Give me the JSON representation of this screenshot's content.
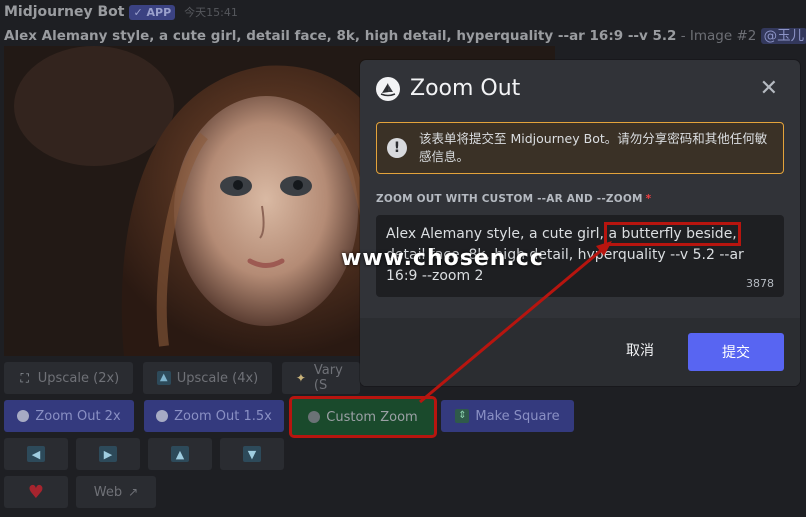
{
  "message": {
    "author": "Midjourney Bot",
    "app_badge": "✓ APP",
    "timestamp": "今天15:41",
    "prompt_bold": "Alex Alemany style, a cute girl, detail face, 8k, high detail, hyperquality --ar 16:9 --v 5.2",
    "prompt_suffix": " - Image #2 ",
    "mention": "@玉儿"
  },
  "buttons": {
    "upscale_2x": "Upscale (2x)",
    "upscale_4x": "Upscale (4x)",
    "vary": "Vary (S",
    "zoom_out_2x": "Zoom Out 2x",
    "zoom_out_15x": "Zoom Out 1.5x",
    "custom_zoom": "Custom Zoom",
    "make_square": "Make Square",
    "web": "Web"
  },
  "modal": {
    "title": "Zoom Out",
    "warning": "该表单将提交至 Midjourney Bot。请勿分享密码和其他任何敏感信息。",
    "field_label": "ZOOM OUT WITH CUSTOM --AR AND --ZOOM",
    "field_required": "*",
    "text_before": "Alex Alemany style, a cute girl,",
    "text_highlight": "a butterfly beside,",
    "text_after": " detail face, 8k, high detail, hyperquality --v 5.2 --ar 16:9 --zoom 2",
    "char_count": "3878",
    "cancel": "取消",
    "submit": "提交"
  },
  "watermark": "www.chosen.cc",
  "colors": {
    "accent": "#5865f2",
    "warning_border": "#e3a33b",
    "annotation_red": "#b7150f"
  }
}
